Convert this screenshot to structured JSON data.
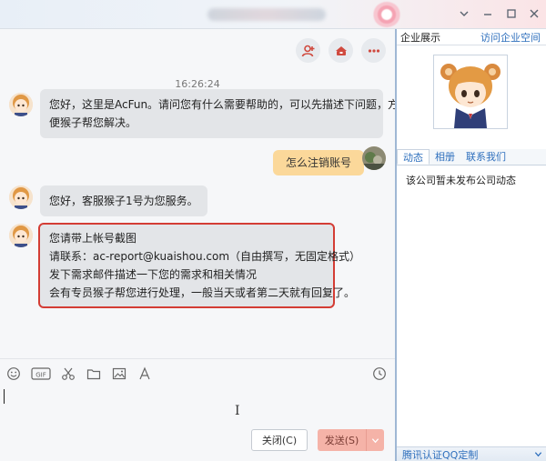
{
  "window": {
    "controls": [
      "chevron-down",
      "minimize",
      "maximize",
      "close"
    ]
  },
  "chat": {
    "toolbar_icons": [
      "add-contact-icon",
      "transfer-icon",
      "more-icon"
    ],
    "timestamp": "16:26:24",
    "messages": [
      {
        "from": "agent",
        "lines": [
          "您好，这里是AcFun。请问您有什么需要帮助的，可以先描述下问题，方",
          "便猴子帮您解决。"
        ]
      },
      {
        "from": "me",
        "lines": [
          "怎么注销账号"
        ]
      },
      {
        "from": "agent",
        "lines": [
          "您好，客服猴子1号为您服务。"
        ]
      },
      {
        "from": "agent",
        "highlighted": true,
        "lines": [
          "您请带上帐号截图",
          "请联系：ac-report@kuaishou.com（自由撰写，无固定格式）",
          "发下需求邮件描述一下您的需求和相关情况",
          "会有专员猴子帮您进行处理，一般当天或者第二天就有回复了。"
        ]
      }
    ],
    "input_toolbar": [
      "emoji-icon",
      "gif-icon",
      "scissors-icon",
      "folder-icon",
      "image-icon",
      "font-icon",
      "history-clock-icon"
    ],
    "input_value": "",
    "close_button": "关闭(C)",
    "send_button": "发送(S)"
  },
  "sidebar": {
    "title": "企业展示",
    "link": "访问企业空间",
    "tabs": [
      "动态",
      "相册",
      "联系我们"
    ],
    "active_tab": 0,
    "body_text": "该公司暂未发布公司动态",
    "footer_label": "腾讯认证QQ定制"
  },
  "colors": {
    "accent": "#2e6fbd",
    "highlight_border": "#d43d35",
    "my_bubble": "#fbd89a",
    "agent_bubble": "#e3e5e8",
    "send_button": "#f5b3a8"
  }
}
